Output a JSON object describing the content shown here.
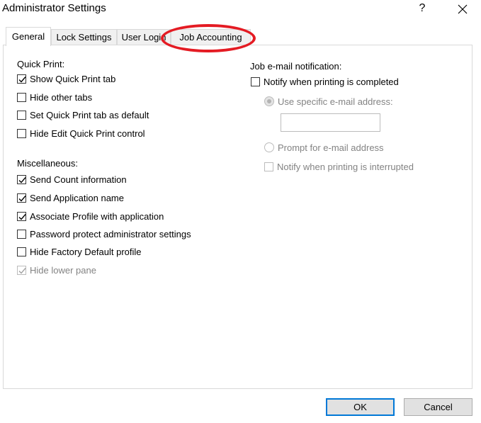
{
  "window": {
    "title": "Administrator Settings",
    "help_label": "?"
  },
  "tabs": [
    {
      "label": "General",
      "active": true
    },
    {
      "label": "Lock Settings",
      "active": false
    },
    {
      "label": "User Login",
      "active": false
    },
    {
      "label": "Job Accounting",
      "active": false
    }
  ],
  "quick_print": {
    "heading": "Quick Print:",
    "options": [
      {
        "label": "Show Quick Print tab",
        "checked": true,
        "disabled": false
      },
      {
        "label": "Hide other tabs",
        "checked": false,
        "disabled": false
      },
      {
        "label": "Set Quick Print tab as default",
        "checked": false,
        "disabled": false
      },
      {
        "label": "Hide Edit Quick Print control",
        "checked": false,
        "disabled": false
      }
    ]
  },
  "miscellaneous": {
    "heading": "Miscellaneous:",
    "options": [
      {
        "label": "Send Count information",
        "checked": true,
        "disabled": false
      },
      {
        "label": "Send Application name",
        "checked": true,
        "disabled": false
      },
      {
        "label": "Associate Profile with application",
        "checked": true,
        "disabled": false
      },
      {
        "label": "Password protect administrator settings",
        "checked": false,
        "disabled": false
      },
      {
        "label": "Hide Factory Default profile",
        "checked": false,
        "disabled": false
      },
      {
        "label": "Hide lower pane",
        "checked": true,
        "disabled": true
      }
    ]
  },
  "email_notification": {
    "heading": "Job e-mail notification:",
    "notify_completed": {
      "label": "Notify when printing is completed",
      "checked": false
    },
    "use_specific": {
      "label": "Use specific e-mail address:",
      "selected": true,
      "disabled": true
    },
    "email_value": "",
    "prompt_email": {
      "label": "Prompt for e-mail address",
      "selected": false,
      "disabled": true
    },
    "notify_interrupted": {
      "label": "Notify when printing is interrupted",
      "checked": false,
      "disabled": true
    }
  },
  "buttons": {
    "ok_label": "OK",
    "cancel_label": "Cancel"
  },
  "colors": {
    "accent": "#0078d7",
    "annotation": "#e41b23"
  }
}
